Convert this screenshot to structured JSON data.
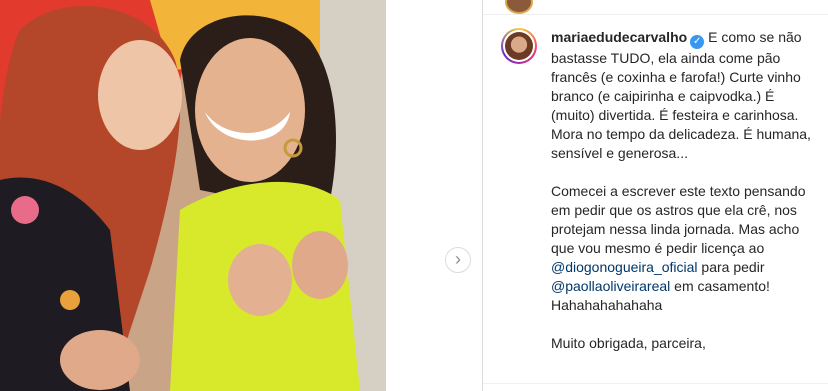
{
  "post": {
    "username": "mariaedudecarvalho",
    "verified_glyph": "✓",
    "caption": {
      "lines_1": "E como se não bastasse TUDO, ela ainda come pão francês (e coxinha e farofa!) Curte vinho branco (e caipirinha e caipvodka.) É (muito) divertida. É festeira e carinhosa.\nMora no tempo da delicadeza. É humana, sensível e generosa...\n\nComecei a escrever este texto pensando em pedir que os astros que ela crê, nos protejam nessa linda jornada. Mas acho que vou mesmo é pedir licença ao ",
      "mention_1": "@diogonogueira_oficial",
      "lines_2": " para pedir ",
      "mention_2": "@paollaoliveirareal",
      "lines_3": " em casamento!\nHahahahahahaha\n\nMuito obrigada, parceira,"
    }
  },
  "carousel": {
    "next_glyph": "›"
  },
  "icons": {
    "next": "chevron-right-icon",
    "verified": "verified-badge-icon"
  },
  "colors": {
    "link": "#00376b",
    "verified": "#3897f0",
    "text": "#262626"
  }
}
